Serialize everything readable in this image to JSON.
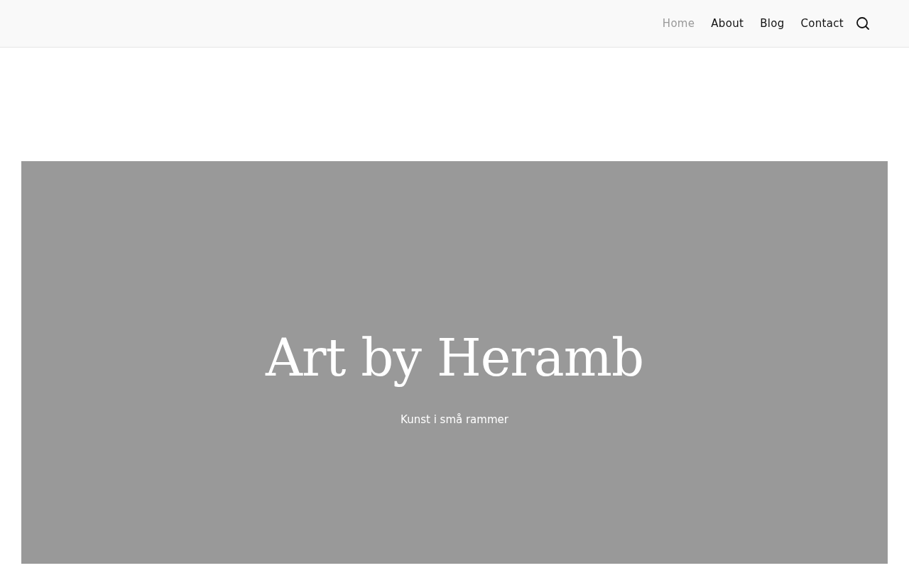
{
  "nav": {
    "items": [
      {
        "label": "Home",
        "selected": true
      },
      {
        "label": "About",
        "selected": false
      },
      {
        "label": "Blog",
        "selected": false
      },
      {
        "label": "Contact",
        "selected": false
      }
    ]
  },
  "hero": {
    "title": "Art by Heramb",
    "tagline": "Kunst i små rammer"
  }
}
